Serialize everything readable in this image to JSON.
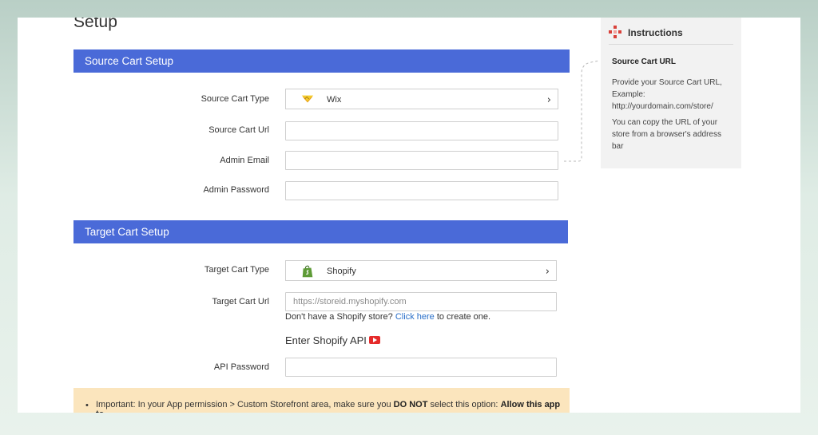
{
  "page": {
    "title": "Setup"
  },
  "source_section": {
    "title": "Source Cart Setup",
    "cart_type_label": "Source Cart Type",
    "cart_type_value": "Wix",
    "cart_url_label": "Source Cart Url",
    "cart_url_value": "",
    "admin_email_label": "Admin Email",
    "admin_email_value": "",
    "admin_password_label": "Admin Password",
    "admin_password_value": ""
  },
  "target_section": {
    "title": "Target Cart Setup",
    "cart_type_label": "Target Cart Type",
    "cart_type_value": "Shopify",
    "cart_url_label": "Target Cart Url",
    "cart_url_placeholder": "https://storeid.myshopify.com",
    "helper_prefix": "Don't have a Shopify store?",
    "helper_link": "Click here",
    "helper_suffix": "to create one.",
    "api_heading": "Enter Shopify API",
    "api_password_label": "API Password",
    "api_password_value": ""
  },
  "notice": {
    "prefix": "Important: In your App permission > Custom Storefront area, make sure you",
    "emphasis": "DO NOT",
    "middle": "select this option:",
    "option": "Allow this app to"
  },
  "instructions": {
    "title": "Instructions",
    "subtitle": "Source Cart URL",
    "line1": "Provide your Source Cart URL, Example: http://yourdomain.com/store/",
    "line2": "You can copy the URL of your store from a browser's address bar"
  },
  "colors": {
    "section_bar": "#4a6ad8",
    "notice_bg": "#fbe5bd",
    "link": "#2a6fc9",
    "pointer": "#e8792a",
    "youtube": "#e52b2b"
  },
  "icons": {
    "wix": "wix-logo-icon",
    "shopify": "shopify-bag-icon",
    "chevron": "chevron-right-icon",
    "youtube": "youtube-play-icon",
    "instructions": "instructions-icon"
  }
}
